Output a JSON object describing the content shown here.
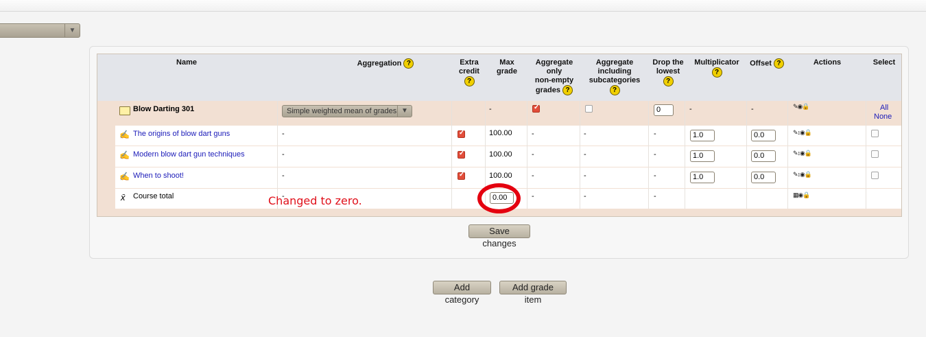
{
  "header": {
    "name": "Name",
    "aggregation": "Aggregation",
    "extra_credit": [
      "Extra",
      "credit"
    ],
    "max_grade": [
      "Max",
      "grade"
    ],
    "aggregate_only": [
      "Aggregate",
      "only",
      "non-empty",
      "grades"
    ],
    "aggregate_including": [
      "Aggregate",
      "including",
      "subcategories"
    ],
    "drop_lowest": [
      "Drop the",
      "lowest"
    ],
    "multiplicator": "Multiplicator",
    "offset": "Offset",
    "actions": "Actions",
    "select": "Select",
    "help_glyph": "?"
  },
  "category": {
    "name": "Blow Darting 301",
    "aggregation": "Simple weighted mean of grades",
    "max_grade": "-",
    "aggregate_only_checked": true,
    "aggregate_including_checked": false,
    "drop_lowest": "0",
    "multiplicator": "-",
    "offset": "-",
    "select_all": "All",
    "select_none": "None"
  },
  "items": [
    {
      "name": "The origins of blow dart guns",
      "aggregation": "-",
      "extra_credit": true,
      "max_grade": "100.00",
      "aggregate_only": "-",
      "aggregate_including": "-",
      "drop_lowest": "-",
      "multiplicator": "1.0",
      "offset": "0.0"
    },
    {
      "name": "Modern blow dart gun techniques",
      "aggregation": "-",
      "extra_credit": true,
      "max_grade": "100.00",
      "aggregate_only": "-",
      "aggregate_including": "-",
      "drop_lowest": "-",
      "multiplicator": "1.0",
      "offset": "0.0"
    },
    {
      "name": "When to shoot!",
      "aggregation": "-",
      "extra_credit": true,
      "max_grade": "100.00",
      "aggregate_only": "-",
      "aggregate_including": "-",
      "drop_lowest": "-",
      "multiplicator": "1.0",
      "offset": "0.0"
    }
  ],
  "course_total": {
    "symbol": "x̄",
    "name": "Course total",
    "aggregation": "-",
    "max_grade": "0.00",
    "aggregate_only": "-",
    "aggregate_including": "-",
    "drop_lowest": "-"
  },
  "annotation": "Changed to zero.",
  "buttons": {
    "save": "Save changes",
    "add_category": "Add category",
    "add_grade_item": "Add grade item"
  },
  "colors": {
    "annotation": "#e0101a",
    "checkbox_checked": "#e24d3a",
    "link": "#1a1ab8",
    "category_row": "#f2e0d3"
  }
}
